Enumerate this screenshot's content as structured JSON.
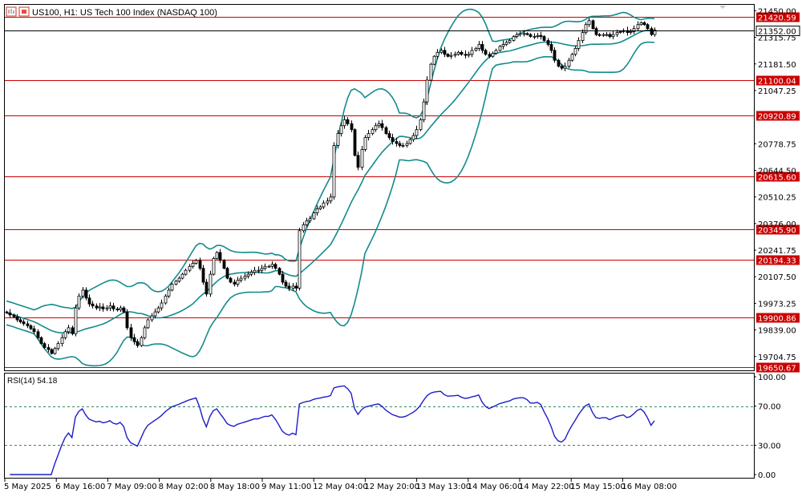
{
  "header": {
    "title": "US100, H1:  US Tech 100 Index (NASDAQ 100)",
    "icons": [
      "chart-icon",
      "symbol-icon"
    ]
  },
  "colors": {
    "grid_border": "#000000",
    "levels": "#cc0000",
    "bands": "#138b8b",
    "rsi": "#1d1dc8",
    "rsi_levels": "#2e8b57",
    "candles": "#000000",
    "price_tag": "#000000"
  },
  "chart_data": [
    {
      "type": "candlestick",
      "title": "US100, H1:  US Tech 100 Index (NASDAQ 100)",
      "ylim": [
        19635,
        21480
      ],
      "y_ticks": [
        "21450.00",
        "21315.75",
        "21181.50",
        "21047.25",
        "20778.75",
        "20644.50",
        "20510.25",
        "20376.00",
        "20241.75",
        "20107.50",
        "19973.25",
        "19839.00",
        "19704.75"
      ],
      "x_ticks": [
        "5 May 2025",
        "6 May 16:00",
        "7 May 09:00",
        "8 May 02:00",
        "8 May 18:00",
        "9 May 11:00",
        "12 May 04:00",
        "12 May 20:00",
        "13 May 13:00",
        "14 May 06:00",
        "14 May 22:00",
        "15 May 15:00",
        "16 May 08:00"
      ],
      "levels": [
        "21420.59",
        "21100.04",
        "20920.89",
        "20615.60",
        "20345.90",
        "20194.33",
        "19900.86",
        "19650.67"
      ],
      "current_price": "21352.00",
      "overlays": [
        "Bollinger Bands (upper, middle, lower)"
      ],
      "close_series": [
        19925,
        19915,
        19905,
        19890,
        19880,
        19870,
        19860,
        19845,
        19830,
        19800,
        19770,
        19750,
        19740,
        19720,
        19745,
        19770,
        19800,
        19830,
        19850,
        19820,
        19950,
        20010,
        20040,
        20000,
        19970,
        19960,
        19950,
        19955,
        19945,
        19950,
        19960,
        19945,
        19940,
        19950,
        19930,
        19850,
        19800,
        19780,
        19760,
        19800,
        19850,
        19890,
        19910,
        19930,
        19950,
        19975,
        20010,
        20040,
        20070,
        20085,
        20100,
        20120,
        20140,
        20160,
        20175,
        20190,
        20150,
        20080,
        20020,
        20120,
        20200,
        20230,
        20190,
        20150,
        20100,
        20080,
        20070,
        20090,
        20100,
        20110,
        20120,
        20130,
        20140,
        20140,
        20150,
        20160,
        20160,
        20170,
        20150,
        20120,
        20080,
        20060,
        20050,
        20060,
        20050,
        20340,
        20370,
        20390,
        20400,
        20430,
        20450,
        20460,
        20480,
        20490,
        20510,
        20770,
        20830,
        20870,
        20900,
        20880,
        20850,
        20720,
        20660,
        20750,
        20810,
        20830,
        20850,
        20870,
        20880,
        20860,
        20830,
        20810,
        20790,
        20780,
        20770,
        20770,
        20780,
        20800,
        20820,
        20850,
        20900,
        20990,
        21100,
        21180,
        21220,
        21240,
        21250,
        21230,
        21220,
        21225,
        21230,
        21240,
        21230,
        21225,
        21230,
        21250,
        21260,
        21280,
        21250,
        21230,
        21220,
        21235,
        21250,
        21270,
        21280,
        21290,
        21300,
        21320,
        21330,
        21335,
        21335,
        21330,
        21320,
        21320,
        21325,
        21320,
        21300,
        21280,
        21250,
        21200,
        21170,
        21160,
        21170,
        21200,
        21230,
        21260,
        21300,
        21340,
        21380,
        21400,
        21360,
        21330,
        21325,
        21330,
        21330,
        21320,
        21330,
        21340,
        21345,
        21350,
        21340,
        21345,
        21360,
        21380,
        21390,
        21380,
        21360,
        21330,
        21352
      ],
      "rsi": {
        "label": "RSI(14) 54.18",
        "period": 14,
        "value": 54.18,
        "levels": [
          70,
          30
        ],
        "ylim": [
          0,
          100
        ],
        "y_ticks": [
          "100.00",
          "70.00",
          "30.00",
          "0.00"
        ]
      }
    }
  ]
}
